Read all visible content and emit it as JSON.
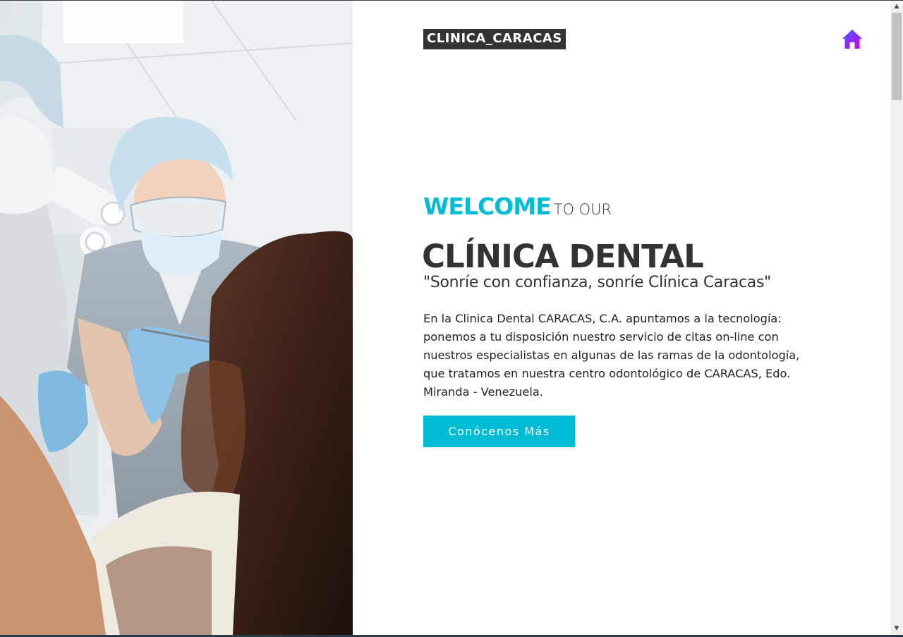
{
  "header": {
    "brand": "CLINICA_CARACAS",
    "home_icon": "home-icon"
  },
  "hero": {
    "welcome_word": "WELCOME",
    "welcome_rest": "TO OUR",
    "title": "CLÍNICA DENTAL",
    "slogan": "\"Sonríe con confianza, sonríe Clínica Caracas\"",
    "description": "En la Clinica Dental CARACAS, C.A. apuntamos a la tecnología: ponemos a tu disposición nuestro servicio de citas on-line con nuestros especialistas en algunas de las ramas de la odontología, que tratamos en nuestra centro odontológico de CARACAS, Edo. Miranda - Venezuela.",
    "cta_label": "Conócenos Más"
  },
  "colors": {
    "accent": "#00bcd4",
    "text_dark": "#333333",
    "home_icon_gradient": [
      "#3d5afe",
      "#d500f9"
    ]
  }
}
